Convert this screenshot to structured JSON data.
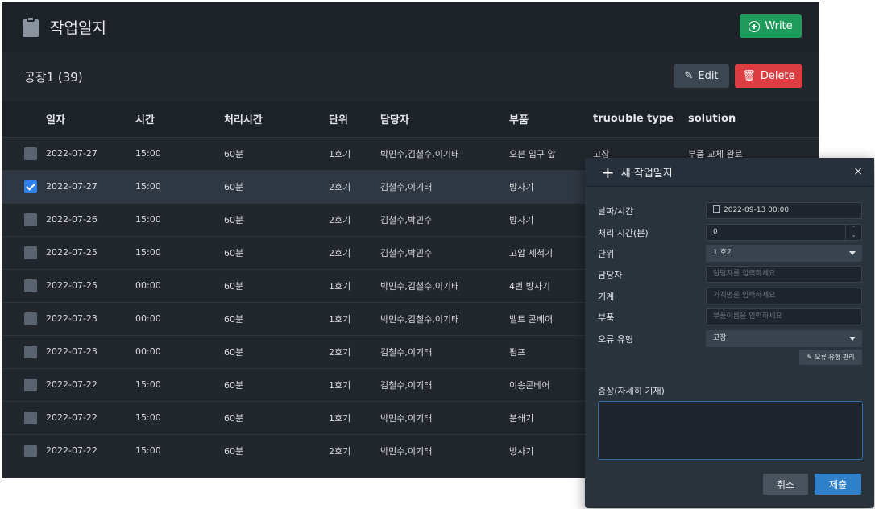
{
  "header": {
    "title": "작업일지",
    "write_label": "Write"
  },
  "subheader": {
    "group_title": "공장1 (39)",
    "edit_label": "Edit",
    "delete_label": "Delete"
  },
  "table": {
    "columns": [
      "일자",
      "시간",
      "처리시간",
      "단위",
      "담당자",
      "부품",
      "truouble type",
      "solution"
    ],
    "rows": [
      {
        "checked": false,
        "date": "2022-07-27",
        "time": "15:00",
        "duration": "60분",
        "unit": "1호기",
        "staff": "박민수,김철수,이기태",
        "part": "오븐 입구 앞",
        "type": "고장",
        "solution": "부품 교체 완료"
      },
      {
        "checked": true,
        "date": "2022-07-27",
        "time": "15:00",
        "duration": "60분",
        "unit": "2호기",
        "staff": "김철수,이기태",
        "part": "방사기",
        "type": "",
        "solution": ""
      },
      {
        "checked": false,
        "date": "2022-07-26",
        "time": "15:00",
        "duration": "60분",
        "unit": "2호기",
        "staff": "김철수,박민수",
        "part": "방사기",
        "type": "",
        "solution": ""
      },
      {
        "checked": false,
        "date": "2022-07-25",
        "time": "15:00",
        "duration": "60분",
        "unit": "2호기",
        "staff": "김철수,박민수",
        "part": "고압 세척기",
        "type": "",
        "solution": ""
      },
      {
        "checked": false,
        "date": "2022-07-25",
        "time": "00:00",
        "duration": "60분",
        "unit": "1호기",
        "staff": "박민수,김철수,이기태",
        "part": "4번 방사기",
        "type": "",
        "solution": ""
      },
      {
        "checked": false,
        "date": "2022-07-23",
        "time": "00:00",
        "duration": "60분",
        "unit": "1호기",
        "staff": "박민수,김철수,이기태",
        "part": "벨트 콘베어",
        "type": "",
        "solution": ""
      },
      {
        "checked": false,
        "date": "2022-07-23",
        "time": "00:00",
        "duration": "60분",
        "unit": "2호기",
        "staff": "김철수,이기태",
        "part": "펌프",
        "type": "",
        "solution": ""
      },
      {
        "checked": false,
        "date": "2022-07-22",
        "time": "15:00",
        "duration": "60분",
        "unit": "1호기",
        "staff": "김철수,이기태",
        "part": "이송콘베어",
        "type": "",
        "solution": ""
      },
      {
        "checked": false,
        "date": "2022-07-22",
        "time": "15:00",
        "duration": "60분",
        "unit": "1호기",
        "staff": "박민수,이기태",
        "part": "분쇄기",
        "type": "",
        "solution": ""
      },
      {
        "checked": false,
        "date": "2022-07-22",
        "time": "15:00",
        "duration": "60분",
        "unit": "2호기",
        "staff": "박민수,이기태",
        "part": "방사기",
        "type": "",
        "solution": ""
      }
    ]
  },
  "modal": {
    "title": "새 작업일지",
    "close_icon": "×",
    "fields": {
      "datetime": {
        "label": "날짜/시간",
        "value": "2022-09-13 00:00"
      },
      "duration": {
        "label": "처리 시간(분)",
        "value": "0"
      },
      "unit": {
        "label": "단위",
        "value": "1 호기"
      },
      "staff": {
        "label": "담당자",
        "placeholder": "담당자를 입력하세요"
      },
      "machine": {
        "label": "기계",
        "placeholder": "기계명을 입력하세요"
      },
      "part": {
        "label": "부품",
        "placeholder": "부품이름을 입력하세요"
      },
      "error_type": {
        "label": "오류 유형",
        "value": "고장"
      }
    },
    "manage_label": "오류 유형 관리",
    "symptom_label": "증상(자세히 기재)",
    "cancel_label": "취소",
    "submit_label": "제출"
  }
}
